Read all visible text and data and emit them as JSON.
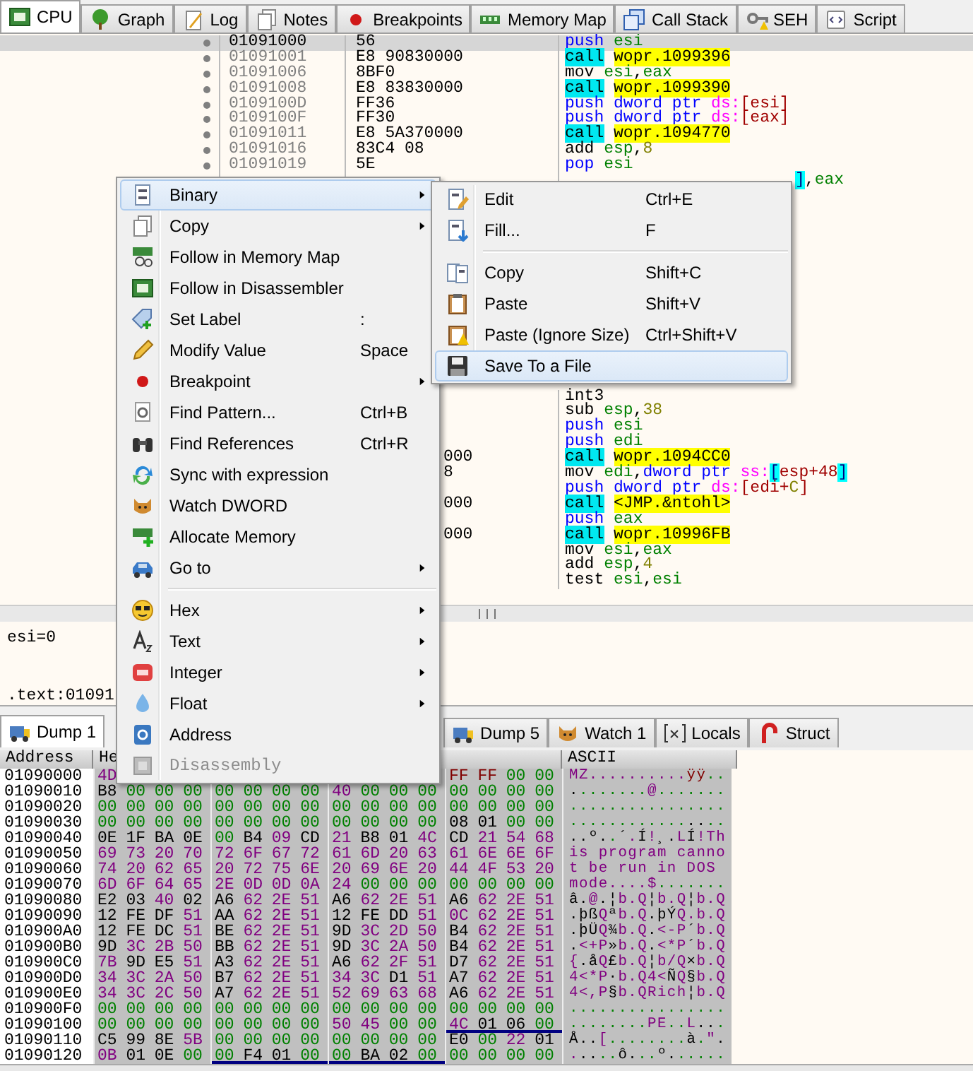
{
  "top_tabs": [
    {
      "label": "CPU",
      "selected": true
    },
    {
      "label": "Graph",
      "selected": false
    },
    {
      "label": "Log",
      "selected": false
    },
    {
      "label": "Notes",
      "selected": false
    },
    {
      "label": "Breakpoints",
      "selected": false
    },
    {
      "label": "Memory Map",
      "selected": false
    },
    {
      "label": "Call Stack",
      "selected": false
    },
    {
      "label": "SEH",
      "selected": false
    },
    {
      "label": "Script",
      "selected": false
    }
  ],
  "disassembly": {
    "rows": [
      {
        "address": "01091000",
        "bytes": "56",
        "selected": true,
        "instruction": [
          {
            "text": "push",
            "kind": "stack",
            "space": true
          },
          {
            "text": "esi",
            "kind": "register"
          }
        ]
      },
      {
        "address": "01091001",
        "bytes": "E8 90830000",
        "selected": false,
        "instruction": [
          {
            "text": "call",
            "kind": "call",
            "space": true
          },
          {
            "text": "wopr.1099396",
            "kind": "target"
          }
        ]
      },
      {
        "address": "01091006",
        "bytes": "8BF0",
        "selected": false,
        "instruction": [
          {
            "text": "mov",
            "kind": "mnemonic",
            "space": true
          },
          {
            "text": "esi",
            "kind": "register"
          },
          {
            "text": ",",
            "kind": "plain"
          },
          {
            "text": "eax",
            "kind": "register"
          }
        ]
      },
      {
        "address": "01091008",
        "bytes": "E8 83830000",
        "selected": false,
        "instruction": [
          {
            "text": "call",
            "kind": "call",
            "space": true
          },
          {
            "text": "wopr.1099390",
            "kind": "target"
          }
        ]
      },
      {
        "address": "0109100D",
        "bytes": "FF36",
        "selected": false,
        "instruction": [
          {
            "text": "push",
            "kind": "stack",
            "space": true
          },
          {
            "text": "dword ptr",
            "kind": "size",
            "space": true
          },
          {
            "text": "ds:",
            "kind": "segment"
          },
          {
            "text": "[esi]",
            "kind": "memory"
          }
        ]
      },
      {
        "address": "0109100F",
        "bytes": "FF30",
        "selected": false,
        "instruction": [
          {
            "text": "push",
            "kind": "stack",
            "space": true
          },
          {
            "text": "dword ptr",
            "kind": "size",
            "space": true
          },
          {
            "text": "ds:",
            "kind": "segment"
          },
          {
            "text": "[eax]",
            "kind": "memory"
          }
        ]
      },
      {
        "address": "01091011",
        "bytes": "E8 5A370000",
        "selected": false,
        "instruction": [
          {
            "text": "call",
            "kind": "call",
            "space": true
          },
          {
            "text": "wopr.1094770",
            "kind": "target"
          }
        ]
      },
      {
        "address": "01091016",
        "bytes": "83C4 08",
        "selected": false,
        "instruction": [
          {
            "text": "add",
            "kind": "mnemonic",
            "space": true
          },
          {
            "text": "esp",
            "kind": "register"
          },
          {
            "text": ",",
            "kind": "plain"
          },
          {
            "text": "8",
            "kind": "number"
          }
        ]
      },
      {
        "address": "01091019",
        "bytes": "5E",
        "selected": false,
        "instruction": [
          {
            "text": "pop",
            "kind": "stack",
            "space": true
          },
          {
            "text": "esi",
            "kind": "register"
          }
        ]
      }
    ],
    "partial_row": {
      "instruction": [
        {
          "text": "]",
          "kind": "bracket"
        },
        {
          "text": ",",
          "kind": "plain"
        },
        {
          "text": "eax",
          "kind": "register"
        }
      ]
    },
    "lower_rows": [
      {
        "instruction": [
          {
            "text": "int3",
            "kind": "mnemonic"
          }
        ]
      },
      {
        "instruction": [
          {
            "text": "sub",
            "kind": "mnemonic",
            "space": true
          },
          {
            "text": "esp",
            "kind": "register"
          },
          {
            "text": ",",
            "kind": "plain"
          },
          {
            "text": "38",
            "kind": "number"
          }
        ]
      },
      {
        "instruction": [
          {
            "text": "push",
            "kind": "stack",
            "space": true
          },
          {
            "text": "esi",
            "kind": "register"
          }
        ]
      },
      {
        "instruction": [
          {
            "text": "push",
            "kind": "stack",
            "space": true
          },
          {
            "text": "edi",
            "kind": "register"
          }
        ]
      },
      {
        "bytes_tail": "000",
        "instruction": [
          {
            "text": "call",
            "kind": "call",
            "space": true
          },
          {
            "text": "wopr.1094CC0",
            "kind": "target"
          }
        ]
      },
      {
        "bytes_tail": "8",
        "instruction": [
          {
            "text": "mov",
            "kind": "mnemonic",
            "space": true
          },
          {
            "text": "edi",
            "kind": "register"
          },
          {
            "text": ",",
            "kind": "plain"
          },
          {
            "text": "dword ptr",
            "kind": "size",
            "space": true
          },
          {
            "text": "ss:",
            "kind": "segment"
          },
          {
            "text": "[",
            "kind": "bracket"
          },
          {
            "text": "esp+48",
            "kind": "memory"
          },
          {
            "text": "]",
            "kind": "bracket"
          }
        ]
      },
      {
        "instruction": [
          {
            "text": "push",
            "kind": "stack",
            "space": true
          },
          {
            "text": "dword ptr",
            "kind": "size",
            "space": true
          },
          {
            "text": "ds:",
            "kind": "segment"
          },
          {
            "text": "[edi+",
            "kind": "memory"
          },
          {
            "text": "C",
            "kind": "number"
          },
          {
            "text": "]",
            "kind": "memory"
          }
        ]
      },
      {
        "bytes_tail": "000",
        "instruction": [
          {
            "text": "call",
            "kind": "call",
            "space": true
          },
          {
            "text": "<JMP.&ntohl>",
            "kind": "target"
          }
        ]
      },
      {
        "instruction": [
          {
            "text": "push",
            "kind": "stack",
            "space": true
          },
          {
            "text": "eax",
            "kind": "register"
          }
        ]
      },
      {
        "bytes_tail": "000",
        "instruction": [
          {
            "text": "call",
            "kind": "call",
            "space": true
          },
          {
            "text": "wopr.10996FB",
            "kind": "target"
          }
        ]
      },
      {
        "instruction": [
          {
            "text": "mov",
            "kind": "mnemonic",
            "space": true
          },
          {
            "text": "esi",
            "kind": "register"
          },
          {
            "text": ",",
            "kind": "plain"
          },
          {
            "text": "eax",
            "kind": "register"
          }
        ]
      },
      {
        "instruction": [
          {
            "text": "add",
            "kind": "mnemonic",
            "space": true
          },
          {
            "text": "esp",
            "kind": "register"
          },
          {
            "text": ",",
            "kind": "plain"
          },
          {
            "text": "4",
            "kind": "number"
          }
        ]
      },
      {
        "instruction": [
          {
            "text": "test",
            "kind": "mnemonic",
            "space": true
          },
          {
            "text": "esi",
            "kind": "register"
          },
          {
            "text": ",",
            "kind": "plain"
          },
          {
            "text": "esi",
            "kind": "register"
          }
        ]
      }
    ]
  },
  "info": {
    "lines": [
      "esi=0",
      ".text:01091"
    ]
  },
  "dump_tabs": [
    {
      "label": "Dump 1",
      "selected": true
    },
    {
      "label": "Dump 5",
      "selected": false
    },
    {
      "label": "Watch 1",
      "selected": false
    },
    {
      "label": "Locals",
      "selected": false
    },
    {
      "label": "Struct",
      "selected": false
    }
  ],
  "dump": {
    "columns": [
      "Address",
      "He",
      "ASCII"
    ],
    "rows": [
      {
        "address": "01090000",
        "bytes_start": [
          "4D"
        ],
        "bytes_end": [
          "FF",
          "FF",
          "00",
          "00"
        ],
        "ascii": "MZ..........ÿÿ.."
      },
      {
        "address": "01090010",
        "bytes": [
          "B8",
          "00",
          "00",
          "00",
          "00",
          "00",
          "00",
          "00",
          "40",
          "00",
          "00",
          "00",
          "00",
          "00",
          "00",
          "00"
        ],
        "ascii": "........@......."
      },
      {
        "address": "01090020",
        "bytes": [
          "00",
          "00",
          "00",
          "00",
          "00",
          "00",
          "00",
          "00",
          "00",
          "00",
          "00",
          "00",
          "00",
          "00",
          "00",
          "00"
        ],
        "ascii": "................"
      },
      {
        "address": "01090030",
        "bytes": [
          "00",
          "00",
          "00",
          "00",
          "00",
          "00",
          "00",
          "00",
          "00",
          "00",
          "00",
          "00",
          "08",
          "01",
          "00",
          "00"
        ],
        "ascii": "................"
      },
      {
        "address": "01090040",
        "bytes": [
          "0E",
          "1F",
          "BA",
          "0E",
          "00",
          "B4",
          "09",
          "CD",
          "21",
          "B8",
          "01",
          "4C",
          "CD",
          "21",
          "54",
          "68"
        ],
        "ascii": "..º..´.Í!¸.LÍ!Th"
      },
      {
        "address": "01090050",
        "bytes": [
          "69",
          "73",
          "20",
          "70",
          "72",
          "6F",
          "67",
          "72",
          "61",
          "6D",
          "20",
          "63",
          "61",
          "6E",
          "6E",
          "6F"
        ],
        "ascii": "is program canno"
      },
      {
        "address": "01090060",
        "bytes": [
          "74",
          "20",
          "62",
          "65",
          "20",
          "72",
          "75",
          "6E",
          "20",
          "69",
          "6E",
          "20",
          "44",
          "4F",
          "53",
          "20"
        ],
        "ascii": "t be run in DOS "
      },
      {
        "address": "01090070",
        "bytes": [
          "6D",
          "6F",
          "64",
          "65",
          "2E",
          "0D",
          "0D",
          "0A",
          "24",
          "00",
          "00",
          "00",
          "00",
          "00",
          "00",
          "00"
        ],
        "ascii": "mode....$......."
      },
      {
        "address": "01090080",
        "bytes": [
          "E2",
          "03",
          "40",
          "02",
          "A6",
          "62",
          "2E",
          "51",
          "A6",
          "62",
          "2E",
          "51",
          "A6",
          "62",
          "2E",
          "51"
        ],
        "ascii": "â.@.¦b.Q¦b.Q¦b.Q"
      },
      {
        "address": "01090090",
        "bytes": [
          "12",
          "FE",
          "DF",
          "51",
          "AA",
          "62",
          "2E",
          "51",
          "12",
          "FE",
          "DD",
          "51",
          "0C",
          "62",
          "2E",
          "51"
        ],
        "ascii": ".þßQªb.Q.þÝQ.b.Q"
      },
      {
        "address": "010900A0",
        "bytes": [
          "12",
          "FE",
          "DC",
          "51",
          "BE",
          "62",
          "2E",
          "51",
          "9D",
          "3C",
          "2D",
          "50",
          "B4",
          "62",
          "2E",
          "51"
        ],
        "ascii": ".þÜQ¾b.Q.<-P´b.Q"
      },
      {
        "address": "010900B0",
        "bytes": [
          "9D",
          "3C",
          "2B",
          "50",
          "BB",
          "62",
          "2E",
          "51",
          "9D",
          "3C",
          "2A",
          "50",
          "B4",
          "62",
          "2E",
          "51"
        ],
        "ascii": ".<+P»b.Q.<*P´b.Q"
      },
      {
        "address": "010900C0",
        "bytes": [
          "7B",
          "9D",
          "E5",
          "51",
          "A3",
          "62",
          "2E",
          "51",
          "A6",
          "62",
          "2F",
          "51",
          "D7",
          "62",
          "2E",
          "51"
        ],
        "ascii": "{.åQ£b.Q¦b/Q×b.Q"
      },
      {
        "address": "010900D0",
        "bytes": [
          "34",
          "3C",
          "2A",
          "50",
          "B7",
          "62",
          "2E",
          "51",
          "34",
          "3C",
          "D1",
          "51",
          "A7",
          "62",
          "2E",
          "51"
        ],
        "ascii": "4<*P·b.Q4<ÑQ§b.Q"
      },
      {
        "address": "010900E0",
        "bytes": [
          "34",
          "3C",
          "2C",
          "50",
          "A7",
          "62",
          "2E",
          "51",
          "52",
          "69",
          "63",
          "68",
          "A6",
          "62",
          "2E",
          "51"
        ],
        "ascii": "4<,P§b.QRich¦b.Q"
      },
      {
        "address": "010900F0",
        "bytes": [
          "00",
          "00",
          "00",
          "00",
          "00",
          "00",
          "00",
          "00",
          "00",
          "00",
          "00",
          "00",
          "00",
          "00",
          "00",
          "00"
        ],
        "ascii": "................"
      },
      {
        "address": "01090100",
        "bytes": [
          "00",
          "00",
          "00",
          "00",
          "00",
          "00",
          "00",
          "00",
          "50",
          "45",
          "00",
          "00",
          "4C",
          "01",
          "06",
          "00"
        ],
        "ascii": "........PE..L...",
        "underlined": [
          false,
          false,
          false,
          true
        ]
      },
      {
        "address": "01090110",
        "bytes": [
          "C5",
          "99",
          "8E",
          "5B",
          "00",
          "00",
          "00",
          "00",
          "00",
          "00",
          "00",
          "00",
          "E0",
          "00",
          "22",
          "01"
        ],
        "ascii": "Å..[........à.\"."
      },
      {
        "address": "01090120",
        "bytes": [
          "0B",
          "01",
          "0E",
          "00",
          "00",
          "F4",
          "01",
          "00",
          "00",
          "BA",
          "02",
          "00",
          "00",
          "00",
          "00",
          "00"
        ],
        "ascii": ".....ô...º......",
        "underlined": [
          false,
          true,
          true,
          false
        ]
      }
    ]
  },
  "context_menu": {
    "items": [
      {
        "label": "Binary",
        "submenu": true,
        "highlighted": true
      },
      {
        "label": "Copy",
        "submenu": true,
        "highlighted": false
      },
      {
        "label": "Follow in Memory Map",
        "highlighted": false
      },
      {
        "label": "Follow in Disassembler",
        "highlighted": false
      },
      {
        "label": "Set Label",
        "shortcut": ":",
        "highlighted": false
      },
      {
        "label": "Modify Value",
        "shortcut": "Space",
        "highlighted": false
      },
      {
        "label": "Breakpoint",
        "submenu": true,
        "highlighted": false
      },
      {
        "label": "Find Pattern...",
        "shortcut": "Ctrl+B",
        "highlighted": false
      },
      {
        "label": "Find References",
        "shortcut": "Ctrl+R",
        "highlighted": false
      },
      {
        "label": "Sync with expression",
        "highlighted": false
      },
      {
        "label": "Watch DWORD",
        "highlighted": false
      },
      {
        "label": "Allocate Memory",
        "highlighted": false
      },
      {
        "label": "Go to",
        "submenu": true,
        "highlighted": false
      },
      {
        "kind": "separator"
      },
      {
        "label": "Hex",
        "submenu": true,
        "highlighted": false
      },
      {
        "label": "Text",
        "submenu": true,
        "highlighted": false
      },
      {
        "label": "Integer",
        "submenu": true,
        "highlighted": false
      },
      {
        "label": "Float",
        "submenu": true,
        "highlighted": false
      },
      {
        "label": "Address",
        "highlighted": false
      },
      {
        "label": "Disassembly",
        "highlighted": false,
        "disabled": true
      }
    ],
    "submenu": {
      "items": [
        {
          "label": "Edit",
          "shortcut": "Ctrl+E",
          "highlighted": false
        },
        {
          "label": "Fill...",
          "shortcut": "F",
          "highlighted": false
        },
        {
          "kind": "separator"
        },
        {
          "label": "Copy",
          "shortcut": "Shift+C",
          "highlighted": false
        },
        {
          "label": "Paste",
          "shortcut": "Shift+V",
          "highlighted": false
        },
        {
          "label": "Paste (Ignore Size)",
          "shortcut": "Ctrl+Shift+V",
          "highlighted": false
        },
        {
          "label": "Save To a File",
          "highlighted": true
        }
      ]
    }
  }
}
